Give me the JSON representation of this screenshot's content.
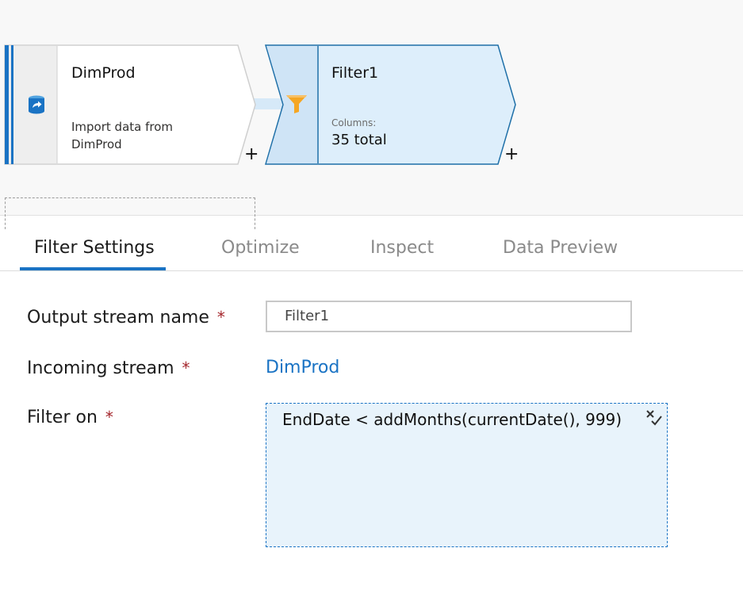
{
  "canvas": {
    "source_node": {
      "title": "DimProd",
      "description_line1": "Import data from",
      "description_line2": "DimProd",
      "icon": "database-source-icon"
    },
    "filter_node": {
      "title": "Filter1",
      "columns_caption": "Columns:",
      "columns_value": "35 total",
      "icon": "filter-funnel-icon"
    },
    "add_symbol": "+"
  },
  "tabs": [
    {
      "label": "Filter Settings",
      "active": true
    },
    {
      "label": "Optimize",
      "active": false
    },
    {
      "label": "Inspect",
      "active": false
    },
    {
      "label": "Data Preview",
      "active": false
    }
  ],
  "form": {
    "required_marker": "*",
    "output_stream": {
      "label": "Output stream name",
      "value": "Filter1"
    },
    "incoming_stream": {
      "label": "Incoming stream",
      "value": "DimProd"
    },
    "filter_on": {
      "label": "Filter on",
      "expression": "EndDate < addMonths(currentDate(), 999)",
      "clear_icon": "clear-expression-icon"
    }
  },
  "colors": {
    "accent": "#1a73c4",
    "required": "#a4262c",
    "selected_node_fill": "#ddeefb",
    "funnel": "#f5a623"
  }
}
